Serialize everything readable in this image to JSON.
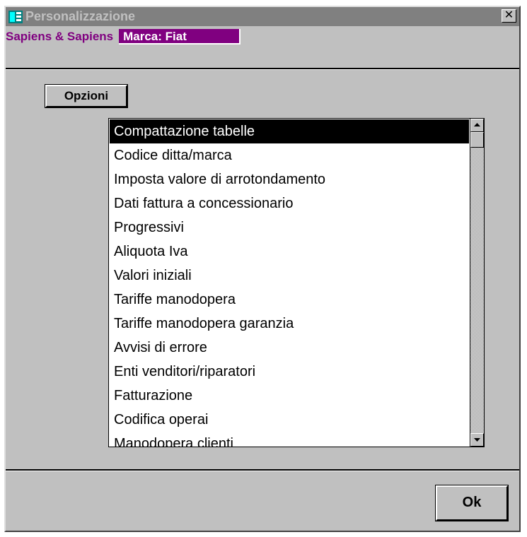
{
  "window": {
    "title": "Personalizzazione",
    "close_glyph": "✕"
  },
  "header": {
    "company": "Sapiens & Sapiens",
    "brand_field": "Marca: Fiat"
  },
  "buttons": {
    "options_label": "Opzioni",
    "ok_label": "Ok"
  },
  "list": {
    "selected_index": 0,
    "items": [
      "Compattazione tabelle",
      "Codice ditta/marca",
      "Imposta valore di arrotondamento",
      "Dati fattura a concessionario",
      "Progressivi",
      "Aliquota Iva",
      "Valori iniziali",
      "Tariffe manodopera",
      "Tariffe manodopera garanzia",
      "Avvisi di errore",
      "Enti venditori/riparatori",
      "Fatturazione",
      "Codifica operai",
      "Manodopera clienti"
    ]
  },
  "colors": {
    "accent": "#800080",
    "window_bg": "#c0c0c0",
    "titlebar_inactive": "#808080"
  }
}
